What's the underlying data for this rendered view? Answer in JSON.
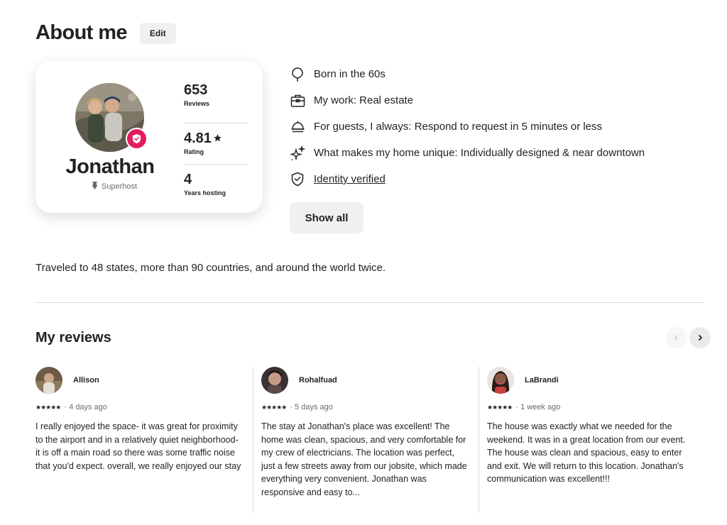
{
  "header": {
    "title": "About me",
    "edit_label": "Edit"
  },
  "profile": {
    "name": "Jonathan",
    "badge_label": "Superhost",
    "stats": [
      {
        "value": "653",
        "label": "Reviews"
      },
      {
        "value": "4.81",
        "label": "Rating"
      },
      {
        "value": "4",
        "label": "Years hosting"
      }
    ]
  },
  "facts": [
    {
      "icon": "balloon-icon",
      "text": "Born in the 60s"
    },
    {
      "icon": "briefcase-icon",
      "text": "My work: Real estate"
    },
    {
      "icon": "service-bell-icon",
      "text": "For guests, I always: Respond to request in 5 minutes or less"
    },
    {
      "icon": "sparkles-icon",
      "text": "What makes my home unique: Individually designed & near downtown"
    },
    {
      "icon": "shield-check-icon",
      "text": "Identity verified"
    }
  ],
  "show_all_label": "Show all",
  "bio": "Traveled to 48 states, more than 90 countries, and around the world twice.",
  "reviews_section": {
    "title": "My reviews",
    "reviews": [
      {
        "name": "Allison",
        "stars": "★★★★★",
        "time": "4 days ago",
        "text": "I really enjoyed the space- it was great for proximity to the airport and in a relatively quiet neighborhood- it is off a main road so there was some traffic noise that you'd expect. overall, we really enjoyed our stay"
      },
      {
        "name": "Rohalfuad",
        "stars": "★★★★★",
        "time": "5 days ago",
        "text": "The stay at Jonathan's place was excellent! The home was clean, spacious, and very comfortable for my crew of electricians. The location was perfect, just a few streets away from our jobsite, which made everything very convenient. Jonathan was responsive and easy to..."
      },
      {
        "name": "LaBrandi",
        "stars": "★★★★★",
        "time": "1 week ago",
        "text": "The house was exactly what we needed for the weekend. It was in a great location from our event. The house was clean and spacious, easy to enter and exit. We will return to this location. Jonathan's communication was excellent!!!"
      }
    ]
  },
  "colors": {
    "accent": "#e31c5f",
    "text": "#222222",
    "muted": "#6a6a6a",
    "divider": "#dddddd"
  }
}
